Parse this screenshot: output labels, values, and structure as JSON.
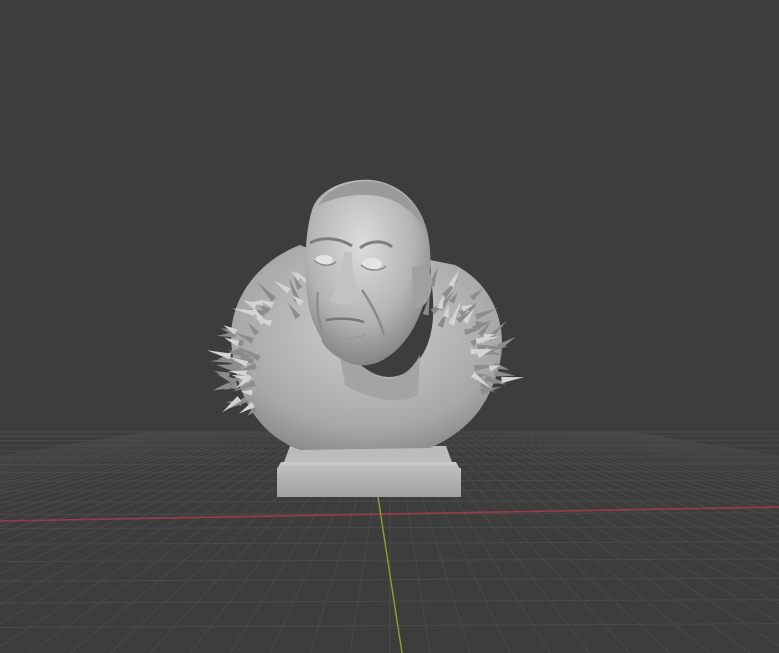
{
  "viewport": {
    "shading": "solid",
    "object_name": "bust",
    "grid_visible": true
  },
  "colors": {
    "background": "#3d3d3d",
    "grid_line": "#4a4a4a",
    "x_axis": "#9a3b48",
    "y_axis": "#8ea12a",
    "model_light": "#d2d2d2",
    "model_mid": "#a9a9a9",
    "model_dark": "#6f6f6f"
  },
  "icons": {
    "axis_x": "x-axis-line",
    "axis_y": "y-axis-line",
    "grid": "floor-grid"
  }
}
